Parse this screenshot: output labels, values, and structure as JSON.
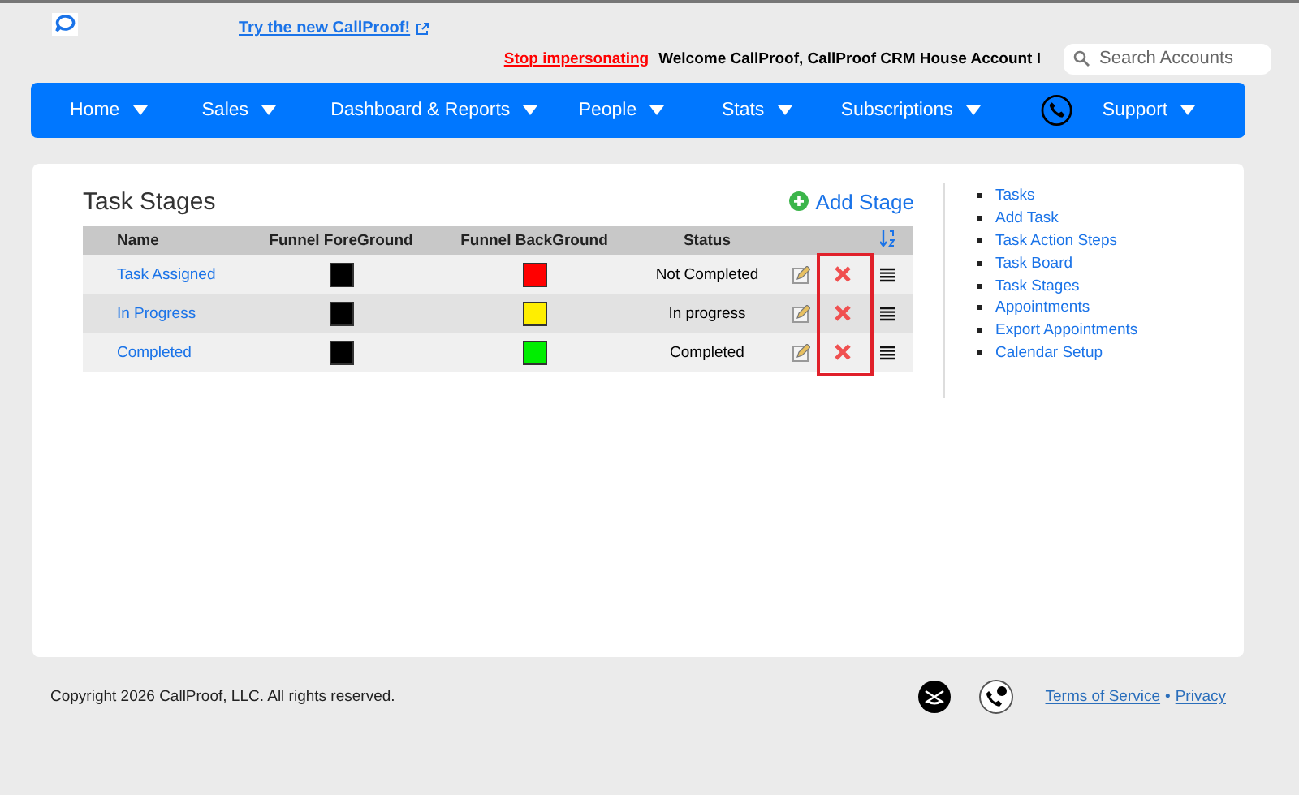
{
  "header": {
    "promo_link": "Try the new CallProof!",
    "stop_link": "Stop impersonating",
    "welcome": "Welcome CallProof, CallProof CRM House Account I",
    "search": {
      "placeholder": "Search Accounts"
    }
  },
  "nav": [
    {
      "label": "Home"
    },
    {
      "label": "Sales"
    },
    {
      "label": "Dashboard & Reports"
    },
    {
      "label": "People"
    },
    {
      "label": "Stats"
    },
    {
      "label": "Subscriptions"
    },
    {
      "label": "Support"
    }
  ],
  "page": {
    "title": "Task Stages",
    "add_button": "Add Stage"
  },
  "table": {
    "columns": [
      "Name",
      "Funnel ForeGround",
      "Funnel BackGround",
      "Status"
    ],
    "rows": [
      {
        "name": "Task Assigned",
        "foreground": {
          "color": "#000000"
        },
        "background": {
          "color": "#ff0000"
        },
        "status": "Not Completed"
      },
      {
        "name": "In Progress",
        "foreground": {
          "color": "#000000"
        },
        "background": {
          "color": "#ffee00"
        },
        "status": "In progress"
      },
      {
        "name": "Completed",
        "foreground": {
          "color": "#000000"
        },
        "background": {
          "color": "#00ee00"
        },
        "status": "Completed"
      }
    ]
  },
  "sidebar": {
    "items": [
      "Tasks",
      "Add Task",
      "Task Action Steps",
      "Task Board",
      "Task Stages",
      "Appointments",
      "Export Appointments",
      "Calendar Setup"
    ]
  },
  "footer": {
    "copyright": "Copyright 2026 CallProof, LLC. All rights reserved.",
    "links": [
      "Terms of Service",
      "Privacy"
    ],
    "separator": "•"
  }
}
